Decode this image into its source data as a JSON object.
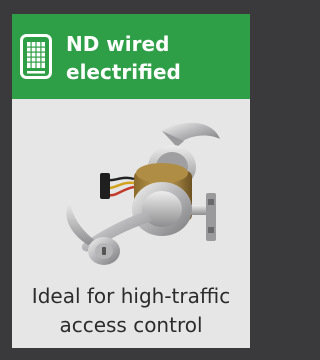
{
  "card": {
    "title": "ND wired\nelectrified",
    "caption": "Ideal for high-traffic access control",
    "icon": "keypad-icon",
    "image": "electrified-lever-lock",
    "colors": {
      "frame": "#3a3a3c",
      "header": "#2f9f47",
      "panel": "#e6e6e7"
    }
  }
}
